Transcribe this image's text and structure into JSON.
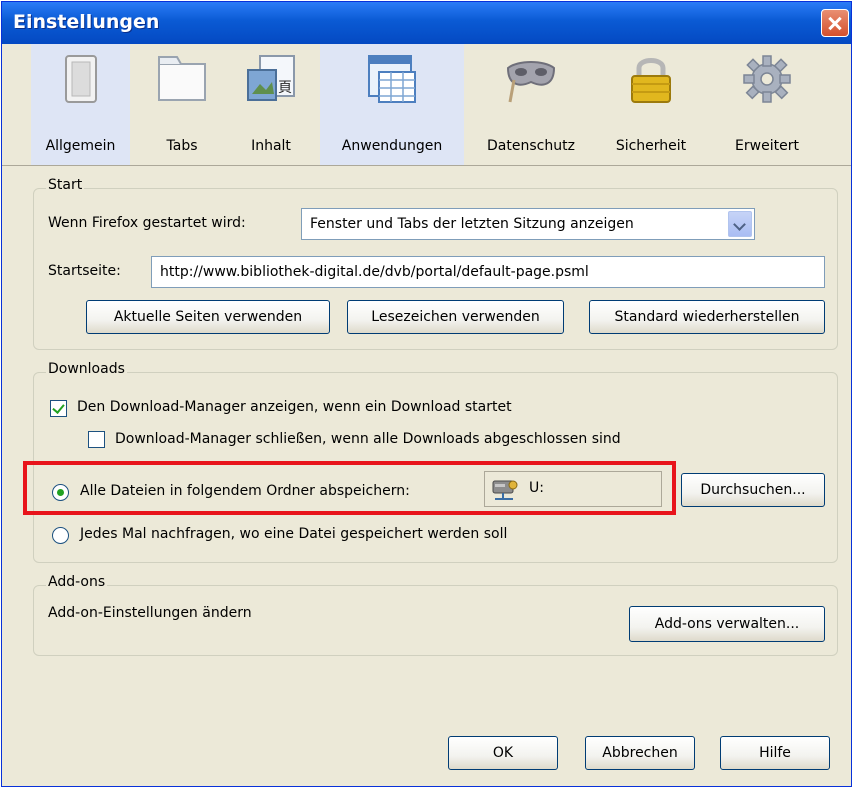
{
  "window": {
    "title": "Einstellungen"
  },
  "tabs": [
    {
      "label": "Allgemein",
      "icon": "switch-icon",
      "active": true
    },
    {
      "label": "Tabs",
      "icon": "tabs-icon"
    },
    {
      "label": "Inhalt",
      "icon": "content-icon"
    },
    {
      "label": "Anwendungen",
      "icon": "applications-icon"
    },
    {
      "label": "Datenschutz",
      "icon": "mask-icon"
    },
    {
      "label": "Sicherheit",
      "icon": "lock-icon"
    },
    {
      "label": "Erweitert",
      "icon": "gear-icon"
    }
  ],
  "start": {
    "legend": "Start",
    "when_label": "Wenn Firefox gestartet wird:",
    "when_value": "Fenster und Tabs der letzten Sitzung anzeigen",
    "homepage_label": "Startseite:",
    "homepage_value": "http://www.bibliothek-digital.de/dvb/portal/default-page.psml",
    "btn_current": "Aktuelle Seiten verwenden",
    "btn_bookmark": "Lesezeichen verwenden",
    "btn_default": "Standard wiederherstellen"
  },
  "downloads": {
    "legend": "Downloads",
    "show_manager": "Den Download-Manager anzeigen, wenn ein Download startet",
    "show_manager_checked": true,
    "close_manager": "Download-Manager schließen, wenn alle Downloads abgeschlossen sind",
    "close_manager_checked": false,
    "save_all": "Alle Dateien in folgendem Ordner abspeichern:",
    "folder": "U:",
    "browse": "Durchsuchen...",
    "ask_each": "Jedes Mal nachfragen, wo eine Datei gespeichert werden soll"
  },
  "addons": {
    "legend": "Add-ons",
    "description": "Add-on-Einstellungen ändern",
    "manage": "Add-ons verwalten..."
  },
  "footer": {
    "ok": "OK",
    "cancel": "Abbrechen",
    "help": "Hilfe"
  },
  "colors": {
    "titlebar": "#0a5ad4",
    "dialog": "#ece9d8",
    "highlight": "#e8141b",
    "check": "#21a121"
  }
}
